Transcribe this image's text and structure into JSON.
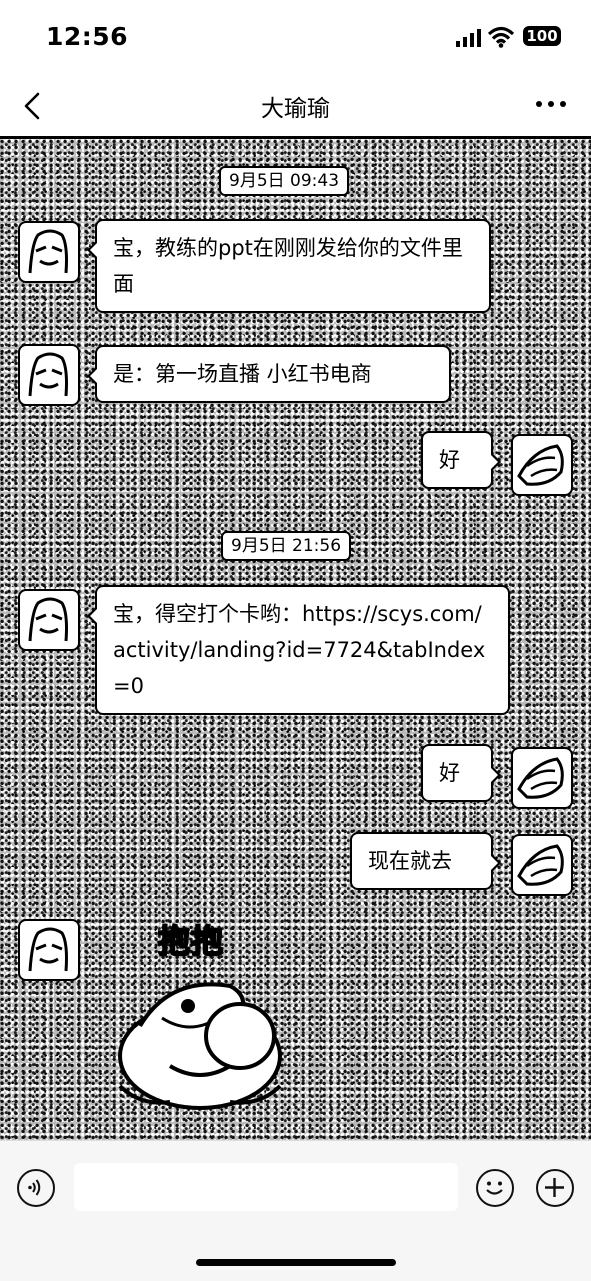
{
  "status_bar": {
    "time": "12:56",
    "battery": "100"
  },
  "nav": {
    "title": "大瑜瑜"
  },
  "messages": [
    {
      "type": "timestamp",
      "text": "9月5日 09:43"
    },
    {
      "type": "incoming",
      "text": "宝，教练的ppt在刚刚发给你的文件里面"
    },
    {
      "type": "incoming",
      "text": "是：第一场直播 小红书电商"
    },
    {
      "type": "outgoing",
      "text": "好"
    },
    {
      "type": "timestamp",
      "text": "9月5日 21:56"
    },
    {
      "type": "incoming",
      "text": "宝，得空打个卡哟：https://scys.com/activity/landing?id=7724&tabIndex=0"
    },
    {
      "type": "outgoing",
      "text": "好"
    },
    {
      "type": "outgoing",
      "text": "现在就去"
    },
    {
      "type": "incoming-sticker",
      "text": "抱抱"
    }
  ]
}
